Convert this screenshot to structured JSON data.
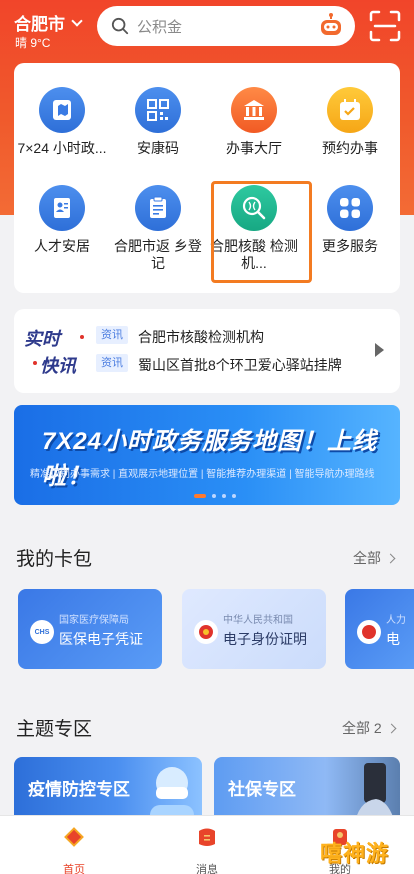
{
  "header": {
    "city": "合肥市",
    "weather": "晴 9°C",
    "search_placeholder": "公积金"
  },
  "services": [
    {
      "label": "7×24 小时政...",
      "icon": "map-clock-icon"
    },
    {
      "label": "安康码",
      "icon": "qr-code-icon"
    },
    {
      "label": "办事大厅",
      "icon": "hall-icon"
    },
    {
      "label": "预约办事",
      "icon": "calendar-icon"
    },
    {
      "label": "人才安居",
      "icon": "id-card-icon"
    },
    {
      "label": "合肥市返 乡登记",
      "icon": "register-icon"
    },
    {
      "label": "合肥核酸 检测机...",
      "icon": "nucleic-test-icon"
    },
    {
      "label": "更多服务",
      "icon": "more-grid-icon"
    }
  ],
  "news": {
    "tag_top": {
      "a": "实时",
      "b": "•"
    },
    "tag_bottom": {
      "a": "•",
      "b": "快讯"
    },
    "items": [
      {
        "badge": "资讯",
        "text": "合肥市核酸检测机构"
      },
      {
        "badge": "资讯",
        "text": "蜀山区首批8个环卫爱心驿站挂牌"
      }
    ]
  },
  "banner": {
    "title": "7X24小时政务服务地图！上线啦！",
    "subtitle": "精准识别办事需求 | 直观展示地理位置 | 智能推荐办理渠道 | 智能导航办理路线",
    "active_index": 0,
    "dots": 4
  },
  "wallet": {
    "title": "我的卡包",
    "more": "全部",
    "cards": [
      {
        "sub": "国家医疗保障局",
        "name": "医保电子凭证",
        "icon": "chs-icon"
      },
      {
        "sub": "中华人民共和国",
        "name": "电子身份证明",
        "icon": "national-emblem-icon"
      },
      {
        "sub": "人力",
        "name": "电",
        "icon": "social-security-icon"
      }
    ]
  },
  "themes": {
    "title": "主题专区",
    "more": "全部 2",
    "items": [
      {
        "label": "疫情防控专区"
      },
      {
        "label": "社保专区"
      }
    ]
  },
  "tabbar": [
    {
      "label": "首页"
    },
    {
      "label": "消息"
    },
    {
      "label": "我的"
    }
  ],
  "watermark": "嘻神游",
  "colors": {
    "brand": "#f1452a",
    "accent": "#f37b21",
    "blue": "#2e6fd8"
  }
}
